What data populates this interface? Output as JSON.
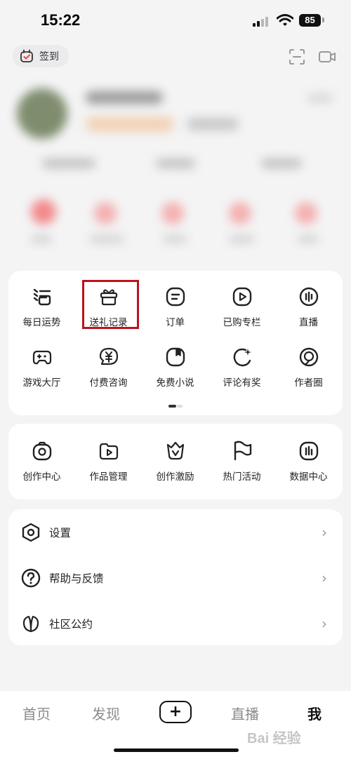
{
  "status_bar": {
    "time": "15:22",
    "battery": "85"
  },
  "top": {
    "signin_label": "签到"
  },
  "services": {
    "items": [
      {
        "label": "每日运势",
        "icon": "fortune-icon"
      },
      {
        "label": "送礼记录",
        "icon": "gift-icon",
        "highlighted": true
      },
      {
        "label": "订单",
        "icon": "order-icon"
      },
      {
        "label": "已购专栏",
        "icon": "purchased-column-icon"
      },
      {
        "label": "直播",
        "icon": "live-icon"
      },
      {
        "label": "游戏大厅",
        "icon": "gamepad-icon"
      },
      {
        "label": "付费咨询",
        "icon": "paid-consult-icon"
      },
      {
        "label": "免费小说",
        "icon": "novel-icon"
      },
      {
        "label": "评论有奖",
        "icon": "comment-reward-icon"
      },
      {
        "label": "作者圈",
        "icon": "author-circle-icon"
      }
    ],
    "highlight_color": "#b8141c"
  },
  "creator": {
    "items": [
      {
        "label": "创作中心",
        "icon": "camera-icon"
      },
      {
        "label": "作品管理",
        "icon": "works-folder-icon"
      },
      {
        "label": "创作激励",
        "icon": "crown-icon"
      },
      {
        "label": "热门活动",
        "icon": "flag-icon"
      },
      {
        "label": "数据中心",
        "icon": "chart-icon"
      }
    ]
  },
  "settings_list": [
    {
      "label": "设置",
      "icon": "settings-hexagon-icon"
    },
    {
      "label": "帮助与反馈",
      "icon": "help-icon"
    },
    {
      "label": "社区公约",
      "icon": "leaf-icon"
    }
  ],
  "tab_bar": {
    "tabs": [
      {
        "label": "首页",
        "active": false
      },
      {
        "label": "发现",
        "active": false
      },
      {
        "label": "直播",
        "active": false
      },
      {
        "label": "我",
        "active": true
      }
    ],
    "center_label": "+"
  },
  "watermark": "Bai 经验"
}
